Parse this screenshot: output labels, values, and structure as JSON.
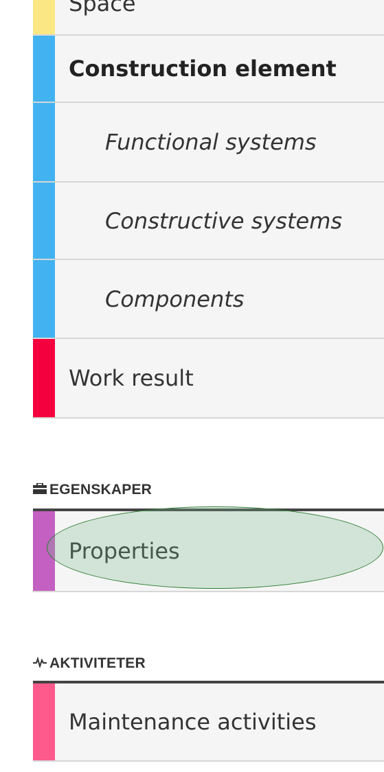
{
  "colors": {
    "space": "#fbe784",
    "construction": "#42b3f0",
    "work_result": "#f5003f",
    "properties": "#c460c2",
    "activities": "#ff5a8c",
    "highlight": "#2e7d32"
  },
  "items": {
    "space": {
      "label": "Space"
    },
    "construction_element": {
      "label": "Construction element"
    },
    "functional_systems": {
      "label": "Functional systems"
    },
    "constructive_systems": {
      "label": "Constructive systems"
    },
    "components": {
      "label": "Components"
    },
    "work_result": {
      "label": "Work result"
    },
    "properties": {
      "label": "Properties"
    },
    "maintenance_activities": {
      "label": "Maintenance activities"
    }
  },
  "sections": {
    "egenskaper": {
      "label": "EGENSKAPER",
      "icon": "briefcase-icon"
    },
    "aktiviteter": {
      "label": "AKTIVITETER",
      "icon": "activity-icon"
    }
  }
}
